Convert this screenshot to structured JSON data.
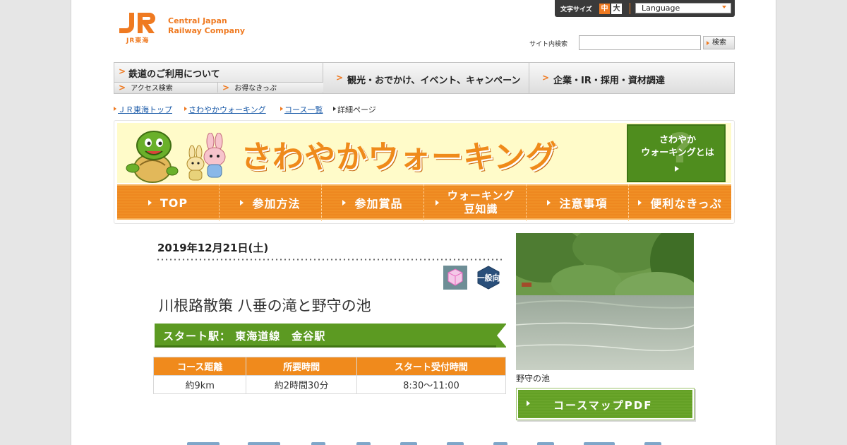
{
  "header": {
    "logo_sub": "JR東海",
    "logo_text_line1": "Central Japan",
    "logo_text_line2": "Railway Company",
    "font_size_label": "文字サイズ",
    "font_size_mid": "中",
    "font_size_big": "大",
    "language_label": "Language",
    "search_label": "サイト内検索",
    "search_value": "",
    "search_button": "検索"
  },
  "global_nav": {
    "railway": "鉄道のご利用について",
    "access": "アクセス検索",
    "tickets": "お得なきっぷ",
    "tourism": "観光・おでかけ、イベント、キャンペーン",
    "corporate": "企業・IR・採用・資材調達"
  },
  "breadcrumb": {
    "items": [
      "ＪＲ東海トップ",
      "さわやかウォーキング",
      "コース一覧"
    ],
    "current": "詳細ページ"
  },
  "banner": {
    "title": "さわやかウォーキング",
    "about_line1": "さわやか",
    "about_line2": "ウォーキングとは",
    "nav": [
      "TOP",
      "参加方法",
      "参加賞品",
      "ウォーキング",
      "豆知識",
      "注意事項",
      "便利なきっぷ"
    ]
  },
  "event": {
    "date": "2019年12月21日(土)",
    "level_badge": "一般向",
    "title": "川根路散策 八垂の滝と野守の池",
    "start_station": "スタート駅：  東海道線　金谷駅",
    "table_headers": [
      "コース距離",
      "所要時間",
      "スタート受付時間"
    ],
    "table_values": [
      "約9km",
      "約2時間30分",
      "8:30～11:00"
    ],
    "photo_caption": "野守の池",
    "pdf_button": "コースマップPDF"
  },
  "colors": {
    "brand_orange": "#ef7a21",
    "nav_orange": "#f08f25",
    "accent_green": "#5c9a22",
    "banner_yellow": "#fffbc9",
    "link_blue": "#1a5aa8"
  },
  "icons": [
    "jr-logo-icon",
    "caret-down-icon",
    "chevron-right-icon",
    "mascot-turtle-icon",
    "mascot-rabbits-icon",
    "cube-icon",
    "hexagon-badge-icon",
    "triangle-arrow-icon"
  ]
}
